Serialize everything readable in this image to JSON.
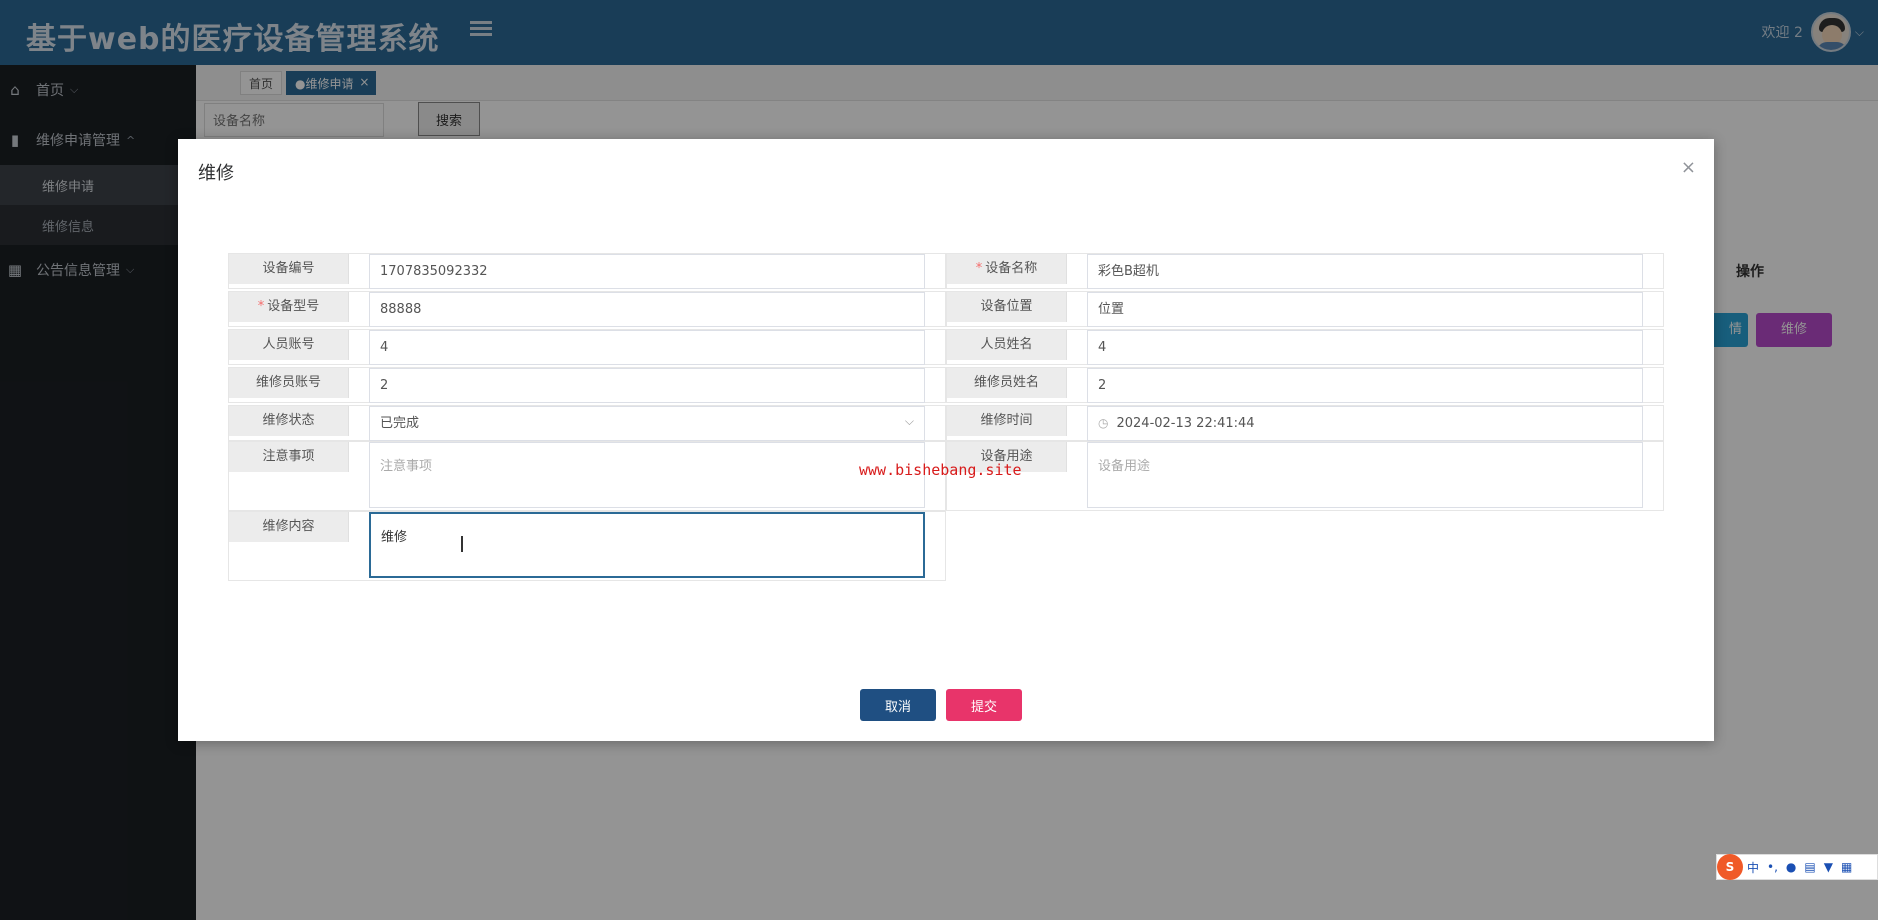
{
  "header": {
    "app_title": "基于web的医疗设备管理系统",
    "welcome": "欢迎 2"
  },
  "sidebar": {
    "items": [
      {
        "label": "首页",
        "icon": "home-icon"
      },
      {
        "label": "维修申请管理",
        "icon": "mouse-icon",
        "subitems": [
          "维修申请",
          "维修信息"
        ]
      },
      {
        "label": "公告信息管理",
        "icon": "grid-icon"
      }
    ]
  },
  "tabs": {
    "home": "首页",
    "current": "●维修申请"
  },
  "search": {
    "placeholder": "设备名称",
    "button": "搜索"
  },
  "table": {
    "op_header": "操作",
    "btn1": "情",
    "btn2": "维修"
  },
  "modal": {
    "title": "维修",
    "fields": {
      "device_no": {
        "label": "设备编号",
        "value": "1707835092332"
      },
      "device_name": {
        "label": "设备名称",
        "value": "彩色B超机",
        "required": "*"
      },
      "device_model": {
        "label": "设备型号",
        "value": "88888",
        "required": "*"
      },
      "device_location": {
        "label": "设备位置",
        "value": "位置"
      },
      "person_account": {
        "label": "人员账号",
        "value": "4"
      },
      "person_name": {
        "label": "人员姓名",
        "value": "4"
      },
      "repairer_account": {
        "label": "维修员账号",
        "value": "2"
      },
      "repairer_name": {
        "label": "维修员姓名",
        "value": "2"
      },
      "repair_status": {
        "label": "维修状态",
        "value": "已完成"
      },
      "repair_time": {
        "label": "维修时间",
        "value": "2024-02-13 22:41:44"
      },
      "notes": {
        "label": "注意事项",
        "placeholder": "注意事项"
      },
      "device_usage": {
        "label": "设备用途",
        "placeholder": "设备用途"
      },
      "repair_content": {
        "label": "维修内容",
        "value": "维修"
      }
    },
    "watermark": "www.bishebang.site",
    "cancel": "取消",
    "submit": "提交"
  },
  "ime": {
    "logo": "S",
    "lang": "中",
    "punct": "•,"
  }
}
